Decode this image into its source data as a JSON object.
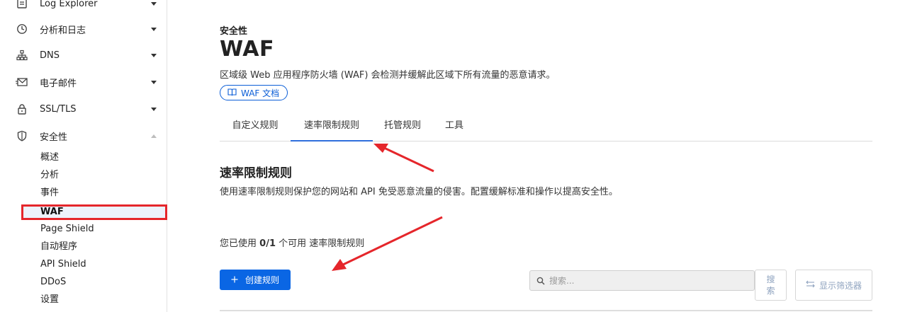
{
  "sidebar": {
    "items": [
      {
        "label": "Log Explorer",
        "icon": "log-explorer-icon"
      },
      {
        "label": "分析和日志",
        "icon": "clock-icon"
      },
      {
        "label": "DNS",
        "icon": "network-tree-icon"
      },
      {
        "label": "电子邮件",
        "icon": "mail-icon"
      },
      {
        "label": "SSL/TLS",
        "icon": "lock-icon"
      },
      {
        "label": "安全性",
        "icon": "shield-icon"
      }
    ],
    "security_subitems": [
      "概述",
      "分析",
      "事件",
      "WAF",
      "Page Shield",
      "自动程序",
      "API Shield",
      "DDoS",
      "设置"
    ],
    "active_subitem": "WAF"
  },
  "header": {
    "eyebrow": "安全性",
    "title": "WAF",
    "description": "区域级 Web 应用程序防火墙 (WAF) 会检测并缓解此区域下所有流量的恶意请求。",
    "doc_link": "WAF 文档"
  },
  "tabs": [
    {
      "label": "自定义规则",
      "active": false
    },
    {
      "label": "速率限制规则",
      "active": true
    },
    {
      "label": "托管规则",
      "active": false
    },
    {
      "label": "工具",
      "active": false
    }
  ],
  "section": {
    "title": "速率限制规则",
    "description": "使用速率限制规则保护您的网站和 API 免受恶意流量的侵害。配置缓解标准和操作以提高安全性。",
    "usage_prefix": "您已使用",
    "usage_count": "0/1",
    "usage_suffix": "个可用 速率限制规则"
  },
  "toolbar": {
    "create_label": "创建规则",
    "search_placeholder": "搜索...",
    "search_button": "搜索",
    "filter_button": "显示筛选器"
  },
  "colors": {
    "accent": "#0a66e4",
    "annotation_red": "#e5262b",
    "active_bg": "#edf2fb"
  }
}
